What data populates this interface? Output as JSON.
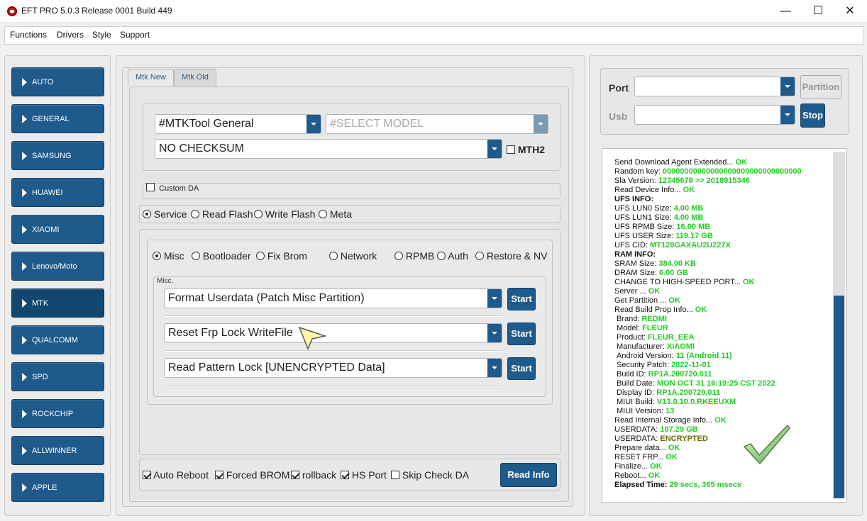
{
  "window": {
    "title": "EFT PRO 5.0.3 Release 0001 Build 449",
    "minimize": "—",
    "maximize": "☐",
    "close": "✕"
  },
  "menu": [
    "Functions",
    "Drivers",
    "Style",
    "Support"
  ],
  "sidebar": [
    {
      "label": "AUTO"
    },
    {
      "label": "GENERAL"
    },
    {
      "label": "SAMSUNG"
    },
    {
      "label": "HUAWEI"
    },
    {
      "label": "XIAOMI"
    },
    {
      "label": "Lenovo/Moto"
    },
    {
      "label": "MTK",
      "active": true
    },
    {
      "label": "QUALCOMM"
    },
    {
      "label": "SPD"
    },
    {
      "label": "ROCKCHIP"
    },
    {
      "label": "ALLWINNER"
    },
    {
      "label": "APPLE"
    }
  ],
  "tabs": [
    {
      "label": "Mtk New",
      "active": true
    },
    {
      "label": "Mtk Old"
    }
  ],
  "tool_combo": "#MTKTool General",
  "model_combo": "#SELECT MODEL",
  "checksum_combo": "NO CHECKSUM",
  "mth2": {
    "label": "MTH2",
    "checked": false
  },
  "custom_da": {
    "label": "Custom DA",
    "checked": false
  },
  "modes": [
    {
      "label": "Service",
      "checked": true
    },
    {
      "label": "Read Flash",
      "checked": false
    },
    {
      "label": "Write Flash",
      "checked": false
    },
    {
      "label": "Meta",
      "checked": false
    }
  ],
  "subtabs": [
    {
      "label": "Misc",
      "checked": true
    },
    {
      "label": "Bootloader",
      "checked": false
    },
    {
      "label": "Fix Brom",
      "checked": false
    },
    {
      "label": "Network",
      "checked": false
    },
    {
      "label": "RPMB",
      "checked": false
    },
    {
      "label": "Auth",
      "checked": false
    },
    {
      "label": "Restore & NV",
      "checked": false
    }
  ],
  "misc_group": "Misc.",
  "operations": [
    {
      "value": "Format Userdata (Patch Misc Partition)",
      "button": "Start"
    },
    {
      "value": "Reset Frp Lock WriteFile",
      "button": "Start"
    },
    {
      "value": "Read Pattern Lock [UNENCRYPTED Data]",
      "button": "Start"
    }
  ],
  "options": [
    {
      "label": "Auto Reboot",
      "checked": true
    },
    {
      "label": "Forced BROM",
      "checked": true
    },
    {
      "label": "rollback",
      "checked": true
    },
    {
      "label": "HS Port",
      "checked": true
    },
    {
      "label": "Skip Check DA",
      "checked": false
    }
  ],
  "read_info_button": "Read Info",
  "connection": {
    "port_label": "Port",
    "usb_label": "Usb",
    "port_value": "",
    "usb_value": "",
    "partition_button": "Partition",
    "stop_button": "Stop"
  },
  "log": [
    {
      "k": "Send Download Agent Extended... ",
      "v": "OK"
    },
    {
      "k": "Random key:  ",
      "v": "00000000000000000000000000000000"
    },
    {
      "k": "Sla Version:  ",
      "v": "12345678  >> 2018915346"
    },
    {
      "k": "Read Device Info... ",
      "v": "OK"
    },
    {
      "k": "UFS INFO:",
      "v": "",
      "bold": true
    },
    {
      "k": "UFS LUN0 Size: ",
      "v": "4.00 MB"
    },
    {
      "k": "UFS LUN1 Size: ",
      "v": "4.00 MB"
    },
    {
      "k": "UFS RPMB Size: ",
      "v": "16.00 MB"
    },
    {
      "k": "UFS USER Size: ",
      "v": "119.17 GB"
    },
    {
      "k": "UFS CID: ",
      "v": "MT128GAXAU2U227X"
    },
    {
      "k": "RAM INFO:",
      "v": "",
      "bold": true
    },
    {
      "k": "SRAM Size: ",
      "v": "384.00 KB"
    },
    {
      "k": "DRAM Size: ",
      "v": "6.00 GB"
    },
    {
      "k": "CHANGE TO HIGH-SPEED PORT... ",
      "v": "OK"
    },
    {
      "k": "Server ... ",
      "v": "OK"
    },
    {
      "k": "Get Partition ... ",
      "v": "OK"
    },
    {
      "k": "Read Build Prop Info... ",
      "v": "OK"
    },
    {
      "k": "Brand: ",
      "v": "REDMI",
      "indent": true
    },
    {
      "k": "Model: ",
      "v": "FLEUR",
      "indent": true
    },
    {
      "k": "Product: ",
      "v": "FLEUR_EEA",
      "indent": true
    },
    {
      "k": "Manufacturer: ",
      "v": "XIAOMI",
      "indent": true
    },
    {
      "k": "Android Version: ",
      "v": "11 (Android 11)",
      "indent": true
    },
    {
      "k": "Security Patch: ",
      "v": "2022-11-01",
      "indent": true
    },
    {
      "k": "Build ID: ",
      "v": "RP1A.200720.011",
      "indent": true
    },
    {
      "k": "Build Date: ",
      "v": "MON OCT 31 16:19:25 CST 2022",
      "indent": true
    },
    {
      "k": "Display ID: ",
      "v": "RP1A.200720.011",
      "indent": true
    },
    {
      "k": "MIUI Build: ",
      "v": "V13.0.10.0.RKEEUXM",
      "indent": true
    },
    {
      "k": "MIUI Version: ",
      "v": "13",
      "indent": true
    },
    {
      "k": "Read Internal Storage Info... ",
      "v": "OK"
    },
    {
      "k": "USERDATA: ",
      "v": "107.29 GB"
    },
    {
      "k": "USERDATA: ",
      "v": "ENCRYPTED",
      "dark": true
    },
    {
      "k": "Prepare data... ",
      "v": "OK"
    },
    {
      "k": "RESET FRP... ",
      "v": "OK"
    },
    {
      "k": "Finalize... ",
      "v": "OK"
    },
    {
      "k": "Reboot... ",
      "v": "OK"
    },
    {
      "k": "Elapsed Time: ",
      "v": "29 secs, 365 msecs",
      "bold": true
    }
  ],
  "icons": {
    "app": "eft-logo-icon",
    "success": "checkmark-icon",
    "cursor": "arrow-cursor-icon"
  }
}
